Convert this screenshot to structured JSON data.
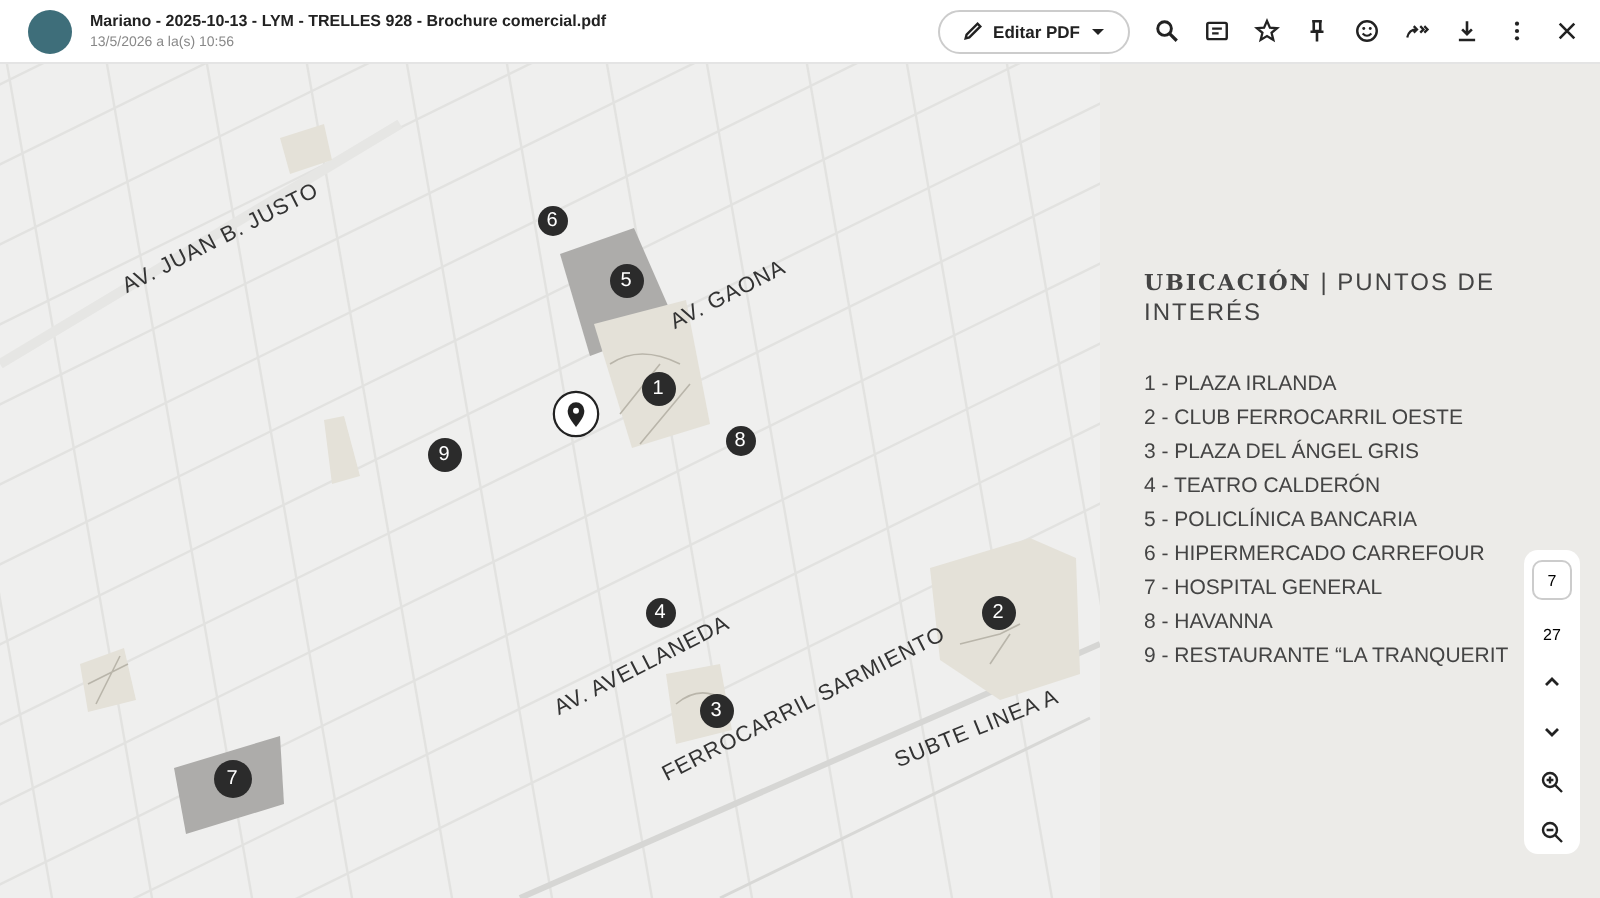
{
  "header": {
    "title": "Mariano - 2025-10-13 - LYM - TRELLES 928 - Brochure comercial.pdf",
    "timestamp": "13/5/2026 a la(s) 10:56",
    "edit_button": "Editar PDF"
  },
  "map": {
    "streets": [
      {
        "label": "AV. JUAN B. JUSTO"
      },
      {
        "label": "AV. GAONA"
      },
      {
        "label": "AV. AVELLANEDA"
      },
      {
        "label": "FERROCARRIL SARMIENTO"
      },
      {
        "label": "SUBTE LINEA A"
      }
    ],
    "markers": [
      {
        "number": "6"
      },
      {
        "number": "5"
      },
      {
        "number": "1"
      },
      {
        "number": "8"
      },
      {
        "number": "9"
      },
      {
        "number": "4"
      },
      {
        "number": "2"
      },
      {
        "number": "3"
      },
      {
        "number": "7"
      }
    ]
  },
  "panel": {
    "heading_serif": "UBICACIÓN",
    "heading_rest": "| PUNTOS DE INTERÉS",
    "items": [
      "1 - PLAZA IRLANDA",
      "2 - CLUB FERROCARRIL OESTE",
      "3 - PLAZA DEL ÁNGEL GRIS",
      "4 - TEATRO CALDERÓN",
      "5 - POLICLÍNICA BANCARIA",
      "6 - HIPERMERCADO CARREFOUR",
      "7 - HOSPITAL GENERAL",
      "8 - HAVANNA",
      "9 - RESTAURANTE “LA TRANQUERIT"
    ]
  },
  "page_controls": {
    "current_page": "7",
    "total_pages": "27"
  }
}
